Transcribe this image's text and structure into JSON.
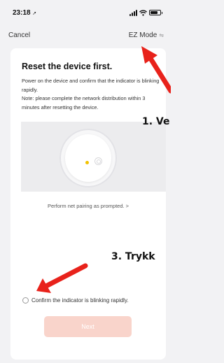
{
  "status_bar": {
    "time": "23:18",
    "location_glyph": "➚"
  },
  "nav": {
    "cancel_label": "Cancel",
    "mode_label": "EZ Mode",
    "mode_icon": "swap-icon"
  },
  "card": {
    "title": "Reset the device first.",
    "desc_line1": "Power on the device and confirm that the indicator is blinking rapidly.",
    "desc_line2": "Note: please complete the network distribution within 3 minutes after resetting the device.",
    "pairing_link": "Perform net pairing as prompted. >",
    "confirm_label": "Confirm the indicator is blinking rapidly.",
    "next_label": "Next"
  },
  "annotations": {
    "step1": "1. Ve",
    "step3": "3. Trykk"
  },
  "colors": {
    "accent_disabled": "#f9d4cb",
    "arrow": "#e8221b",
    "indicator": "#f2c200"
  }
}
